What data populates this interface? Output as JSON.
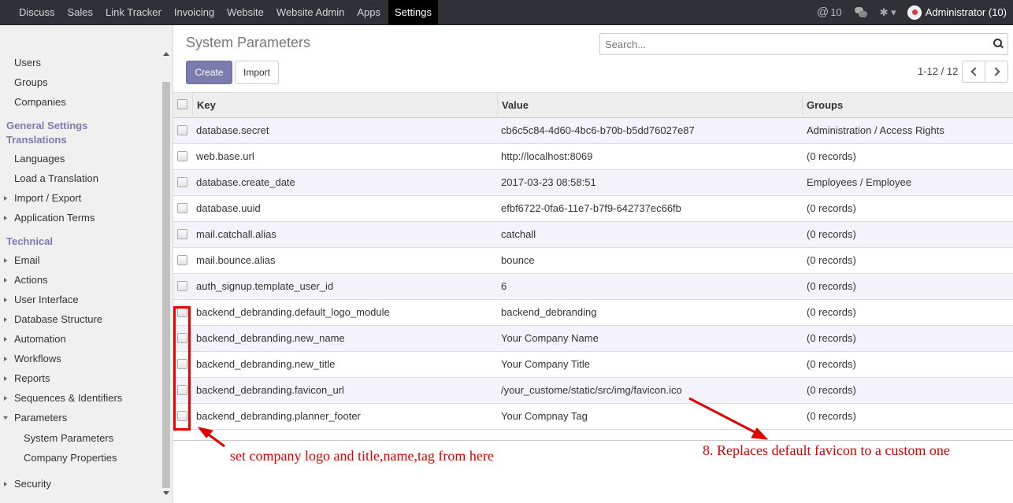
{
  "topbar": {
    "menu": [
      "Discuss",
      "Sales",
      "Link Tracker",
      "Invoicing",
      "Website",
      "Website Admin",
      "Apps",
      "Settings"
    ],
    "active": "Settings",
    "messages_count": "10",
    "user": "Administrator (10)",
    "icons": [
      "at-icon",
      "chat-icon",
      "bug-icon",
      "avatar"
    ]
  },
  "sidebar": {
    "users": "Users",
    "groups": "Groups",
    "companies": "Companies",
    "general_settings": "General Settings",
    "translations": "Translations",
    "languages": "Languages",
    "load_translation": "Load a Translation",
    "import_export": "Import / Export",
    "application_terms": "Application Terms",
    "technical": "Technical",
    "email": "Email",
    "actions": "Actions",
    "user_interface": "User Interface",
    "database_structure": "Database Structure",
    "automation": "Automation",
    "workflows": "Workflows",
    "reports": "Reports",
    "sequences": "Sequences & Identifiers",
    "parameters": "Parameters",
    "system_parameters": "System Parameters",
    "company_properties": "Company Properties",
    "security": "Security"
  },
  "main": {
    "title": "System Parameters",
    "search_placeholder": "Search...",
    "create_label": "Create",
    "import_label": "Import",
    "pager": "1-12 / 12"
  },
  "table": {
    "columns": [
      "Key",
      "Value",
      "Groups"
    ],
    "rows": [
      {
        "key": "database.secret",
        "value": "cb6c5c84-4d60-4bc6-b70b-b5dd76027e87",
        "groups": "Administration / Access Rights"
      },
      {
        "key": "web.base.url",
        "value": "http://localhost:8069",
        "groups": "(0 records)"
      },
      {
        "key": "database.create_date",
        "value": "2017-03-23 08:58:51",
        "groups": "Employees / Employee"
      },
      {
        "key": "database.uuid",
        "value": "efbf6722-0fa6-11e7-b7f9-642737ec66fb",
        "groups": "(0 records)"
      },
      {
        "key": "mail.catchall.alias",
        "value": "catchall",
        "groups": "(0 records)"
      },
      {
        "key": "mail.bounce.alias",
        "value": "bounce",
        "groups": "(0 records)"
      },
      {
        "key": "auth_signup.template_user_id",
        "value": "6",
        "groups": "(0 records)"
      },
      {
        "key": "backend_debranding.default_logo_module",
        "value": "backend_debranding",
        "groups": "(0 records)"
      },
      {
        "key": "backend_debranding.new_name",
        "value": "Your Company Name",
        "groups": "(0 records)"
      },
      {
        "key": "backend_debranding.new_title",
        "value": "Your Company Title",
        "groups": "(0 records)"
      },
      {
        "key": "backend_debranding.favicon_url",
        "value": "/your_custome/static/src/img/favicon.ico",
        "groups": "(0 records)"
      },
      {
        "key": "backend_debranding.planner_footer",
        "value": "Your Compnay Tag",
        "groups": "(0 records)"
      }
    ]
  },
  "annotations": {
    "left_note": "set company logo and title,name,tag from here",
    "right_note": "8. Replaces default favicon to a custom one",
    "color": "#e00000"
  }
}
